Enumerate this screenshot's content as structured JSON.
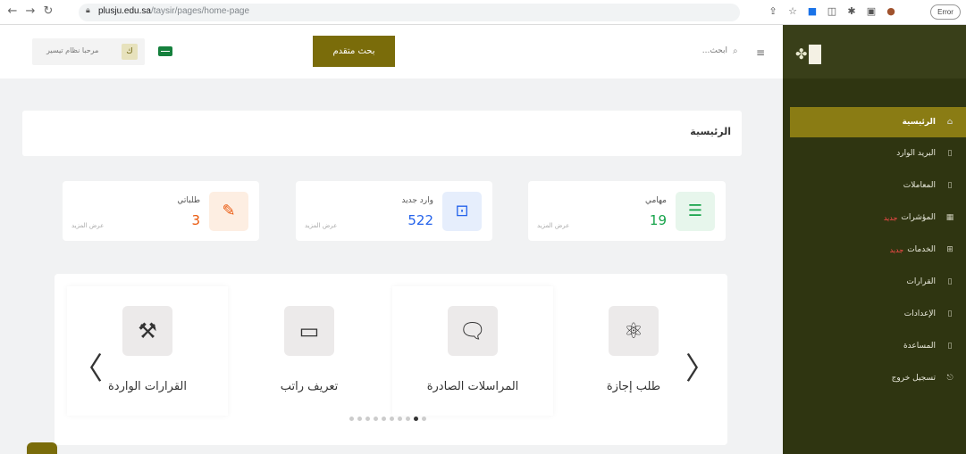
{
  "browser": {
    "url_domain": "plusju.edu.sa",
    "url_path": "/taysir/pages/home-page",
    "error_label": "Error"
  },
  "sidebar": {
    "items": [
      {
        "label": "الرئيسية",
        "icon": "home-icon",
        "active": true
      },
      {
        "label": "البريد الوارد",
        "icon": "file-icon"
      },
      {
        "label": "المعاملات",
        "icon": "file-icon"
      },
      {
        "label": "المؤشرات",
        "badge": "جديد",
        "icon": "chart-icon"
      },
      {
        "label": "الخدمات",
        "badge": "جديد",
        "icon": "services-icon"
      },
      {
        "label": "القرارات",
        "icon": "file-icon"
      },
      {
        "label": "الإعدادات",
        "icon": "file-icon"
      },
      {
        "label": "المساعدة",
        "icon": "file-icon"
      },
      {
        "label": "تسجيل خروج",
        "icon": "logout-icon"
      }
    ]
  },
  "topbar": {
    "search_placeholder": "ابحث...",
    "advanced_search": "بحث متقدم",
    "user_greeting": "مرحبا نظام تيسير",
    "avatar_letter": "ك"
  },
  "breadcrumb": {
    "title": "الرئيسية"
  },
  "stats": [
    {
      "label": "مهامي",
      "value": "19",
      "more": "عرض المزيد",
      "color": "#16a34a"
    },
    {
      "label": "وارد جديد",
      "value": "522",
      "more": "عرض المزيد",
      "color": "#2563eb"
    },
    {
      "label": "طلباتي",
      "value": "3",
      "more": "عرض المزيد",
      "color": "#ea580c"
    }
  ],
  "carousel": {
    "slides": [
      {
        "label": "طلب إجازة",
        "icon": "atom-icon"
      },
      {
        "label": "المراسلات الصادرة",
        "icon": "chat-icon"
      },
      {
        "label": "تعريف راتب",
        "icon": "devices-icon"
      },
      {
        "label": "القرارات الواردة",
        "icon": "gavel-icon"
      }
    ],
    "dot_count": 10,
    "active_dot": 8
  }
}
